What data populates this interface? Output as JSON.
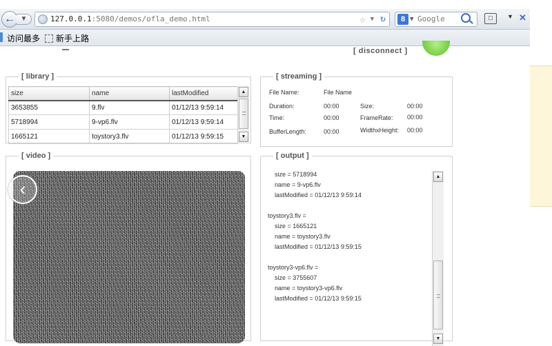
{
  "browser": {
    "url_host": "127.0.0.1",
    "url_rest": ":5080/demos/ofla_demo.html",
    "search_placeholder": "Google",
    "bookmarks": [
      "访问最多",
      "新手上路"
    ]
  },
  "header": {
    "disconnect_label": "[ disconnect ]"
  },
  "library": {
    "legend": "[ library ]",
    "columns": [
      "size",
      "name",
      "lastModified"
    ],
    "rows": [
      [
        "3653855",
        "9.flv",
        "01/12/13 9:59:14"
      ],
      [
        "5718994",
        "9-vp6.flv",
        "01/12/13 9:59:14"
      ],
      [
        "1665121",
        "toystory3.flv",
        "01/12/13 9:59:15"
      ]
    ]
  },
  "streaming": {
    "legend": "[ streaming ]",
    "file_name_label": "File Name:",
    "file_name_value": "File Name",
    "duration_label": "Duration:",
    "duration_value": "00:00",
    "size_label": "Size:",
    "size_value": "00:00",
    "time_label": "Time:",
    "time_value": "00:00",
    "framerate_label": "FrameRate:",
    "framerate_value": "00:00",
    "bufferlength_label": "BufferLength:",
    "bufferlength_value": "00:00",
    "wh_label": "WidthxHeight:",
    "wh_value": "00:00"
  },
  "video": {
    "legend": "[ video ]"
  },
  "output": {
    "legend": "[ output ]",
    "lines": [
      "    size = 5718994",
      "    name = 9-vp6.flv",
      "    lastModified = 01/12/13 9:59:14",
      "",
      "toystory3.flv =",
      "    size = 1665121",
      "    name = toystory3.flv",
      "    lastModified = 01/12/13 9:59:15",
      "",
      "toystory3-vp6.flv =",
      "    size = 3755607",
      "    name = toystory3-vp6.flv",
      "    lastModified = 01/12/13 9:59:15"
    ]
  }
}
